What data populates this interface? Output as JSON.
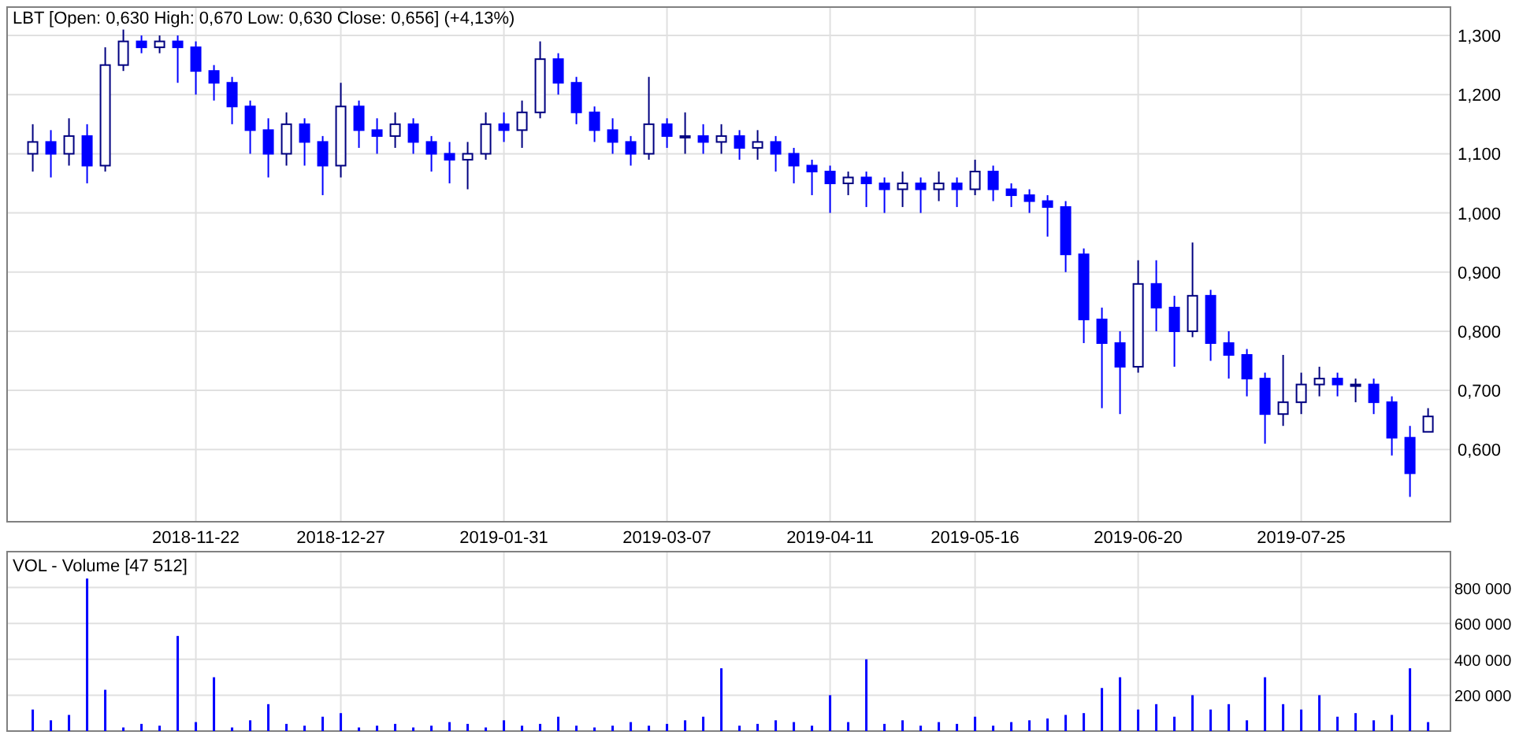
{
  "price_chart": {
    "chart_data": {
      "type": "candlestick",
      "title": "LBT [Open: 0,630  High: 0,670  Low: 0,630  Close: 0,656] (+4,13%)",
      "grid": true,
      "ylim": [
        0.478,
        1.348
      ],
      "yticks": [
        {
          "value": 0.6,
          "label": "0,600"
        },
        {
          "value": 0.7,
          "label": "0,700"
        },
        {
          "value": 0.8,
          "label": "0,800"
        },
        {
          "value": 0.9,
          "label": "0,900"
        },
        {
          "value": 1.0,
          "label": "1,000"
        },
        {
          "value": 1.1,
          "label": "1,100"
        },
        {
          "value": 1.2,
          "label": "1,200"
        },
        {
          "value": 1.3,
          "label": "1,300"
        }
      ],
      "categories": [
        null,
        null,
        null,
        null,
        null,
        null,
        null,
        null,
        null,
        "2018-11-22",
        null,
        null,
        null,
        null,
        null,
        null,
        null,
        "2018-12-27",
        null,
        null,
        null,
        null,
        null,
        null,
        null,
        null,
        "2019-01-31",
        null,
        null,
        null,
        null,
        null,
        null,
        null,
        null,
        "2019-03-07",
        null,
        null,
        null,
        null,
        null,
        null,
        null,
        null,
        "2019-04-11",
        null,
        null,
        null,
        null,
        null,
        null,
        null,
        "2019-05-16",
        null,
        null,
        null,
        null,
        null,
        null,
        null,
        null,
        "2019-06-20",
        null,
        null,
        null,
        null,
        null,
        null,
        null,
        null,
        "2019-07-25",
        null,
        null,
        null,
        null,
        null,
        null,
        null
      ],
      "ohlc": [
        [
          1.1,
          1.15,
          1.07,
          1.12
        ],
        [
          1.12,
          1.14,
          1.06,
          1.1
        ],
        [
          1.1,
          1.16,
          1.08,
          1.13
        ],
        [
          1.13,
          1.15,
          1.05,
          1.08
        ],
        [
          1.08,
          1.28,
          1.07,
          1.25
        ],
        [
          1.25,
          1.31,
          1.24,
          1.29
        ],
        [
          1.29,
          1.3,
          1.27,
          1.28
        ],
        [
          1.28,
          1.3,
          1.27,
          1.29
        ],
        [
          1.29,
          1.3,
          1.22,
          1.28
        ],
        [
          1.28,
          1.29,
          1.2,
          1.24
        ],
        [
          1.24,
          1.25,
          1.19,
          1.22
        ],
        [
          1.22,
          1.23,
          1.15,
          1.18
        ],
        [
          1.18,
          1.19,
          1.1,
          1.14
        ],
        [
          1.14,
          1.16,
          1.06,
          1.1
        ],
        [
          1.1,
          1.17,
          1.08,
          1.15
        ],
        [
          1.15,
          1.16,
          1.08,
          1.12
        ],
        [
          1.12,
          1.13,
          1.03,
          1.08
        ],
        [
          1.08,
          1.22,
          1.06,
          1.18
        ],
        [
          1.18,
          1.19,
          1.11,
          1.14
        ],
        [
          1.14,
          1.16,
          1.1,
          1.13
        ],
        [
          1.13,
          1.17,
          1.11,
          1.15
        ],
        [
          1.15,
          1.16,
          1.1,
          1.12
        ],
        [
          1.12,
          1.13,
          1.07,
          1.1
        ],
        [
          1.1,
          1.12,
          1.05,
          1.09
        ],
        [
          1.09,
          1.12,
          1.04,
          1.1
        ],
        [
          1.1,
          1.17,
          1.09,
          1.15
        ],
        [
          1.15,
          1.17,
          1.12,
          1.14
        ],
        [
          1.14,
          1.19,
          1.11,
          1.17
        ],
        [
          1.17,
          1.29,
          1.16,
          1.26
        ],
        [
          1.26,
          1.27,
          1.2,
          1.22
        ],
        [
          1.22,
          1.23,
          1.15,
          1.17
        ],
        [
          1.17,
          1.18,
          1.12,
          1.14
        ],
        [
          1.14,
          1.16,
          1.1,
          1.12
        ],
        [
          1.12,
          1.13,
          1.08,
          1.1
        ],
        [
          1.1,
          1.23,
          1.09,
          1.15
        ],
        [
          1.15,
          1.16,
          1.11,
          1.13
        ],
        [
          1.13,
          1.17,
          1.1,
          1.13
        ],
        [
          1.13,
          1.15,
          1.1,
          1.12
        ],
        [
          1.12,
          1.15,
          1.1,
          1.13
        ],
        [
          1.13,
          1.14,
          1.09,
          1.11
        ],
        [
          1.11,
          1.14,
          1.09,
          1.12
        ],
        [
          1.12,
          1.13,
          1.07,
          1.1
        ],
        [
          1.1,
          1.11,
          1.05,
          1.08
        ],
        [
          1.08,
          1.09,
          1.03,
          1.07
        ],
        [
          1.07,
          1.08,
          1.0,
          1.05
        ],
        [
          1.05,
          1.07,
          1.03,
          1.06
        ],
        [
          1.06,
          1.07,
          1.01,
          1.05
        ],
        [
          1.05,
          1.06,
          1.0,
          1.04
        ],
        [
          1.04,
          1.07,
          1.01,
          1.05
        ],
        [
          1.05,
          1.06,
          1.0,
          1.04
        ],
        [
          1.04,
          1.07,
          1.02,
          1.05
        ],
        [
          1.05,
          1.06,
          1.01,
          1.04
        ],
        [
          1.04,
          1.09,
          1.03,
          1.07
        ],
        [
          1.07,
          1.08,
          1.02,
          1.04
        ],
        [
          1.04,
          1.05,
          1.01,
          1.03
        ],
        [
          1.03,
          1.04,
          1.0,
          1.02
        ],
        [
          1.02,
          1.03,
          0.96,
          1.01
        ],
        [
          1.01,
          1.02,
          0.9,
          0.93
        ],
        [
          0.93,
          0.94,
          0.78,
          0.82
        ],
        [
          0.82,
          0.84,
          0.67,
          0.78
        ],
        [
          0.78,
          0.8,
          0.66,
          0.74
        ],
        [
          0.74,
          0.92,
          0.73,
          0.88
        ],
        [
          0.88,
          0.92,
          0.8,
          0.84
        ],
        [
          0.84,
          0.86,
          0.74,
          0.8
        ],
        [
          0.8,
          0.95,
          0.79,
          0.86
        ],
        [
          0.86,
          0.87,
          0.75,
          0.78
        ],
        [
          0.78,
          0.8,
          0.72,
          0.76
        ],
        [
          0.76,
          0.77,
          0.69,
          0.72
        ],
        [
          0.72,
          0.73,
          0.61,
          0.66
        ],
        [
          0.66,
          0.76,
          0.64,
          0.68
        ],
        [
          0.68,
          0.73,
          0.66,
          0.71
        ],
        [
          0.71,
          0.74,
          0.69,
          0.72
        ],
        [
          0.72,
          0.73,
          0.69,
          0.71
        ],
        [
          0.71,
          0.72,
          0.68,
          0.71
        ],
        [
          0.71,
          0.72,
          0.66,
          0.68
        ],
        [
          0.68,
          0.69,
          0.59,
          0.62
        ],
        [
          0.62,
          0.64,
          0.52,
          0.56
        ],
        [
          0.63,
          0.67,
          0.63,
          0.656
        ]
      ]
    }
  },
  "volume_chart": {
    "chart_data": {
      "type": "bar",
      "title": "VOL - Volume [47 512]",
      "grid": true,
      "ylim": [
        0,
        1000000
      ],
      "yticks": [
        {
          "value": 200000,
          "label": "200 000"
        },
        {
          "value": 400000,
          "label": "400 000"
        },
        {
          "value": 600000,
          "label": "600 000"
        },
        {
          "value": 800000,
          "label": "800 000"
        }
      ],
      "series": [
        {
          "color": "#0000ff",
          "values": [
            120000,
            60000,
            90000,
            850000,
            230000,
            20000,
            40000,
            30000,
            530000,
            50000,
            300000,
            20000,
            60000,
            150000,
            40000,
            30000,
            80000,
            100000,
            20000,
            30000,
            40000,
            20000,
            30000,
            50000,
            40000,
            20000,
            60000,
            30000,
            40000,
            80000,
            30000,
            20000,
            30000,
            50000,
            30000,
            40000,
            60000,
            80000,
            350000,
            30000,
            40000,
            60000,
            50000,
            30000,
            200000,
            50000,
            400000,
            40000,
            60000,
            30000,
            50000,
            40000,
            80000,
            30000,
            50000,
            60000,
            70000,
            90000,
            100000,
            240000,
            300000,
            120000,
            150000,
            80000,
            200000,
            120000,
            150000,
            60000,
            300000,
            150000,
            120000,
            200000,
            80000,
            100000,
            60000,
            90000,
            350000,
            50000
          ]
        }
      ]
    }
  }
}
